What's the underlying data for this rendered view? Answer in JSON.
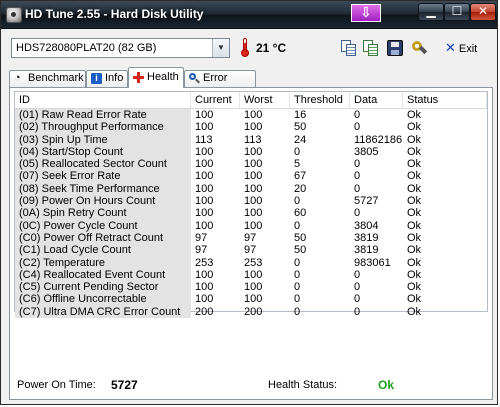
{
  "window": {
    "title": "HD Tune 2.55 - Hard Disk Utility",
    "save_glyph": "⇩",
    "min_glyph": "▁",
    "max_glyph": "☐",
    "close_glyph": "✕"
  },
  "toolbar": {
    "drive": "HDS728080PLAT20 (82 GB)",
    "temperature": "21 °C",
    "exit_x": "✕",
    "exit_label": "Exit",
    "icons": [
      "copy-icon",
      "copy-all-icon",
      "save-icon",
      "options-icon"
    ]
  },
  "tabs": [
    {
      "label": "Benchmark",
      "icon": "gauge-icon"
    },
    {
      "label": "Info",
      "icon": "info-icon"
    },
    {
      "label": "Health",
      "icon": "health-cross-icon",
      "active": true
    },
    {
      "label": "Error Scan",
      "icon": "magnifier-icon"
    }
  ],
  "table": {
    "headers": [
      "ID",
      "Current",
      "Worst",
      "Threshold",
      "Data",
      "Status"
    ],
    "rows": [
      [
        "(01) Raw Read Error Rate",
        "100",
        "100",
        "16",
        "0",
        "Ok"
      ],
      [
        "(02) Throughput Performance",
        "100",
        "100",
        "50",
        "0",
        "Ok"
      ],
      [
        "(03) Spin Up Time",
        "113",
        "113",
        "24",
        "11862186",
        "Ok"
      ],
      [
        "(04) Start/Stop Count",
        "100",
        "100",
        "0",
        "3805",
        "Ok"
      ],
      [
        "(05) Reallocated Sector Count",
        "100",
        "100",
        "5",
        "0",
        "Ok"
      ],
      [
        "(07) Seek Error Rate",
        "100",
        "100",
        "67",
        "0",
        "Ok"
      ],
      [
        "(08) Seek Time Performance",
        "100",
        "100",
        "20",
        "0",
        "Ok"
      ],
      [
        "(09) Power On Hours Count",
        "100",
        "100",
        "0",
        "5727",
        "Ok"
      ],
      [
        "(0A) Spin Retry Count",
        "100",
        "100",
        "60",
        "0",
        "Ok"
      ],
      [
        "(0C) Power Cycle Count",
        "100",
        "100",
        "0",
        "3804",
        "Ok"
      ],
      [
        "(C0) Power Off Retract Count",
        "97",
        "97",
        "50",
        "3819",
        "Ok"
      ],
      [
        "(C1) Load Cycle Count",
        "97",
        "97",
        "50",
        "3819",
        "Ok"
      ],
      [
        "(C2) Temperature",
        "253",
        "253",
        "0",
        "983061",
        "Ok"
      ],
      [
        "(C4) Reallocated Event Count",
        "100",
        "100",
        "0",
        "0",
        "Ok"
      ],
      [
        "(C5) Current Pending Sector",
        "100",
        "100",
        "0",
        "0",
        "Ok"
      ],
      [
        "(C6) Offline Uncorrectable",
        "100",
        "100",
        "0",
        "0",
        "Ok"
      ],
      [
        "(C7) Ultra DMA CRC Error Count",
        "200",
        "200",
        "0",
        "0",
        "Ok"
      ]
    ]
  },
  "footer": {
    "power_on_label": "Power On Time:",
    "power_on_value": "5727",
    "health_label": "Health Status:",
    "health_value": "Ok"
  },
  "colors": {
    "titlebar": "#1d2731",
    "id_column": "#e3e3e3",
    "health_ok": "#1ea21e",
    "save_button": "#c040d8"
  }
}
